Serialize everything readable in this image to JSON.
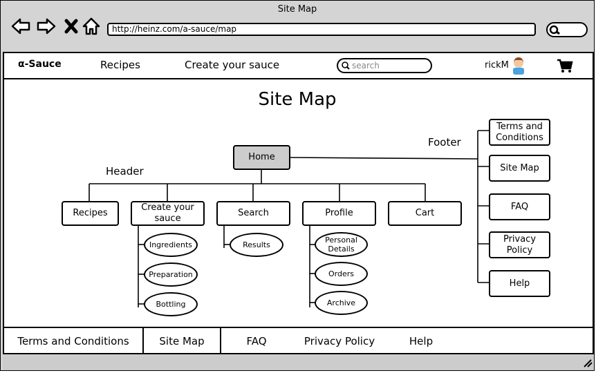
{
  "window": {
    "title": "Site Map"
  },
  "browser": {
    "url": "http://heinz.com/a-sauce/map"
  },
  "topnav": {
    "brand": "α-Sauce",
    "items": [
      "Recipes",
      "Create your sauce"
    ],
    "search_placeholder": "search",
    "username": "rickM"
  },
  "sitemap": {
    "heading": "Site Map",
    "header_label": "Header",
    "footer_label": "Footer",
    "home": "Home",
    "header_items": [
      "Recipes",
      "Create your sauce",
      "Search",
      "Profile",
      "Cart"
    ],
    "create_children": [
      "Ingredients",
      "Preparation",
      "Bottling"
    ],
    "search_children": [
      "Results"
    ],
    "profile_children": [
      "Personal Details",
      "Orders",
      "Archive"
    ],
    "footer_items": [
      "Terms and Conditions",
      "Site Map",
      "FAQ",
      "Privacy Policy",
      "Help"
    ]
  },
  "footer": {
    "tabs": [
      "Terms and Conditions",
      "Site Map",
      "FAQ",
      "Privacy Policy",
      "Help"
    ],
    "active": "Site Map"
  }
}
